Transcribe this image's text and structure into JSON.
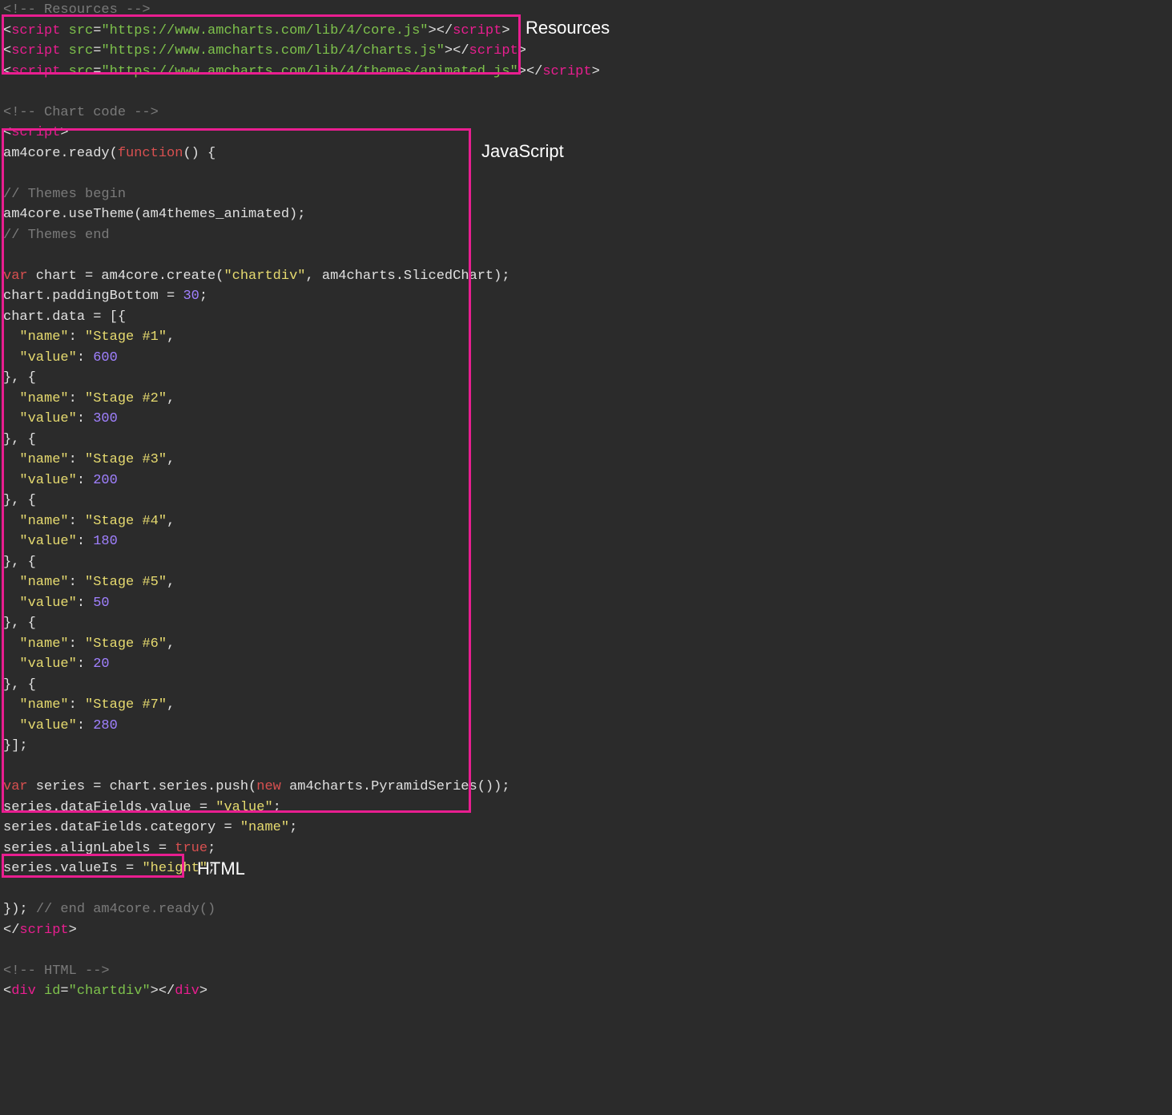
{
  "labels": {
    "resources": "Resources",
    "javascript": "JavaScript",
    "html": "HTML"
  },
  "code": {
    "c1": "<!-- Resources -->",
    "r1_open": "<",
    "r1_tag": "script",
    "r1_sp": " ",
    "r1_attr": "src",
    "r1_eq": "=",
    "r1_val": "\"https://www.amcharts.com/lib/4/core.js\"",
    "r1_c1": ">",
    "r1_ct": "</",
    "r1_ctag": "script",
    "r1_c2": ">",
    "r2_val": "\"https://www.amcharts.com/lib/4/charts.js\"",
    "r3_val": "\"https://www.amcharts.com/lib/4/themes/animated.js\"",
    "c2": "<!-- Chart code -->",
    "sc_open": "<",
    "sc_tag": "script",
    "sc_close": ">",
    "l1a": "am4core.ready(",
    "l1b": "function",
    "l1c": "() {",
    "l2": "// Themes begin",
    "l3": "am4core.useTheme(am4themes_animated);",
    "l4": "// Themes end",
    "l5a": "var",
    "l5b": " chart = am4core.create(",
    "l5c": "\"chartdiv\"",
    "l5d": ", am4charts.SlicedChart);",
    "l6a": "chart.paddingBottom = ",
    "l6b": "30",
    "l6c": ";",
    "l7": "chart.data = [{",
    "kname": "\"name\"",
    "kvalue": "\"value\"",
    "s1n": "\"Stage #1\"",
    "s1v": "600",
    "s2n": "\"Stage #2\"",
    "s2v": "300",
    "s3n": "\"Stage #3\"",
    "s3v": "200",
    "s4n": "\"Stage #4\"",
    "s4v": "180",
    "s5n": "\"Stage #5\"",
    "s5v": "50",
    "s6n": "\"Stage #6\"",
    "s6v": "20",
    "s7n": "\"Stage #7\"",
    "s7v": "280",
    "sep": "}, {",
    "end": "}];",
    "colon": ": ",
    "comma": ",",
    "p1a": "var",
    "p1b": " series = chart.series.push(",
    "p1c": "new",
    "p1d": " am4charts.PyramidSeries());",
    "p2a": "series.dataFields.value = ",
    "p2b": "\"value\"",
    "p2c": ";",
    "p3a": "series.dataFields.category = ",
    "p3b": "\"name\"",
    "p3c": ";",
    "p4a": "series.alignLabels = ",
    "p4b": "true",
    "p4c": ";",
    "p5a": "series.valueIs = ",
    "p5b": "\"height\"",
    "p5c": ";",
    "end1a": "}); ",
    "end1b": "// end am4core.ready()",
    "sc_end_open": "</",
    "sc_end_tag": "script",
    "sc_end_close": ">",
    "c3": "<!-- HTML -->",
    "h_open": "<",
    "h_tag": "div",
    "h_sp": " ",
    "h_attr": "id",
    "h_eq": "=",
    "h_val": "\"chartdiv\"",
    "h_c1": ">",
    "h_ct": "</",
    "h_ctag": "div",
    "h_c2": ">"
  }
}
